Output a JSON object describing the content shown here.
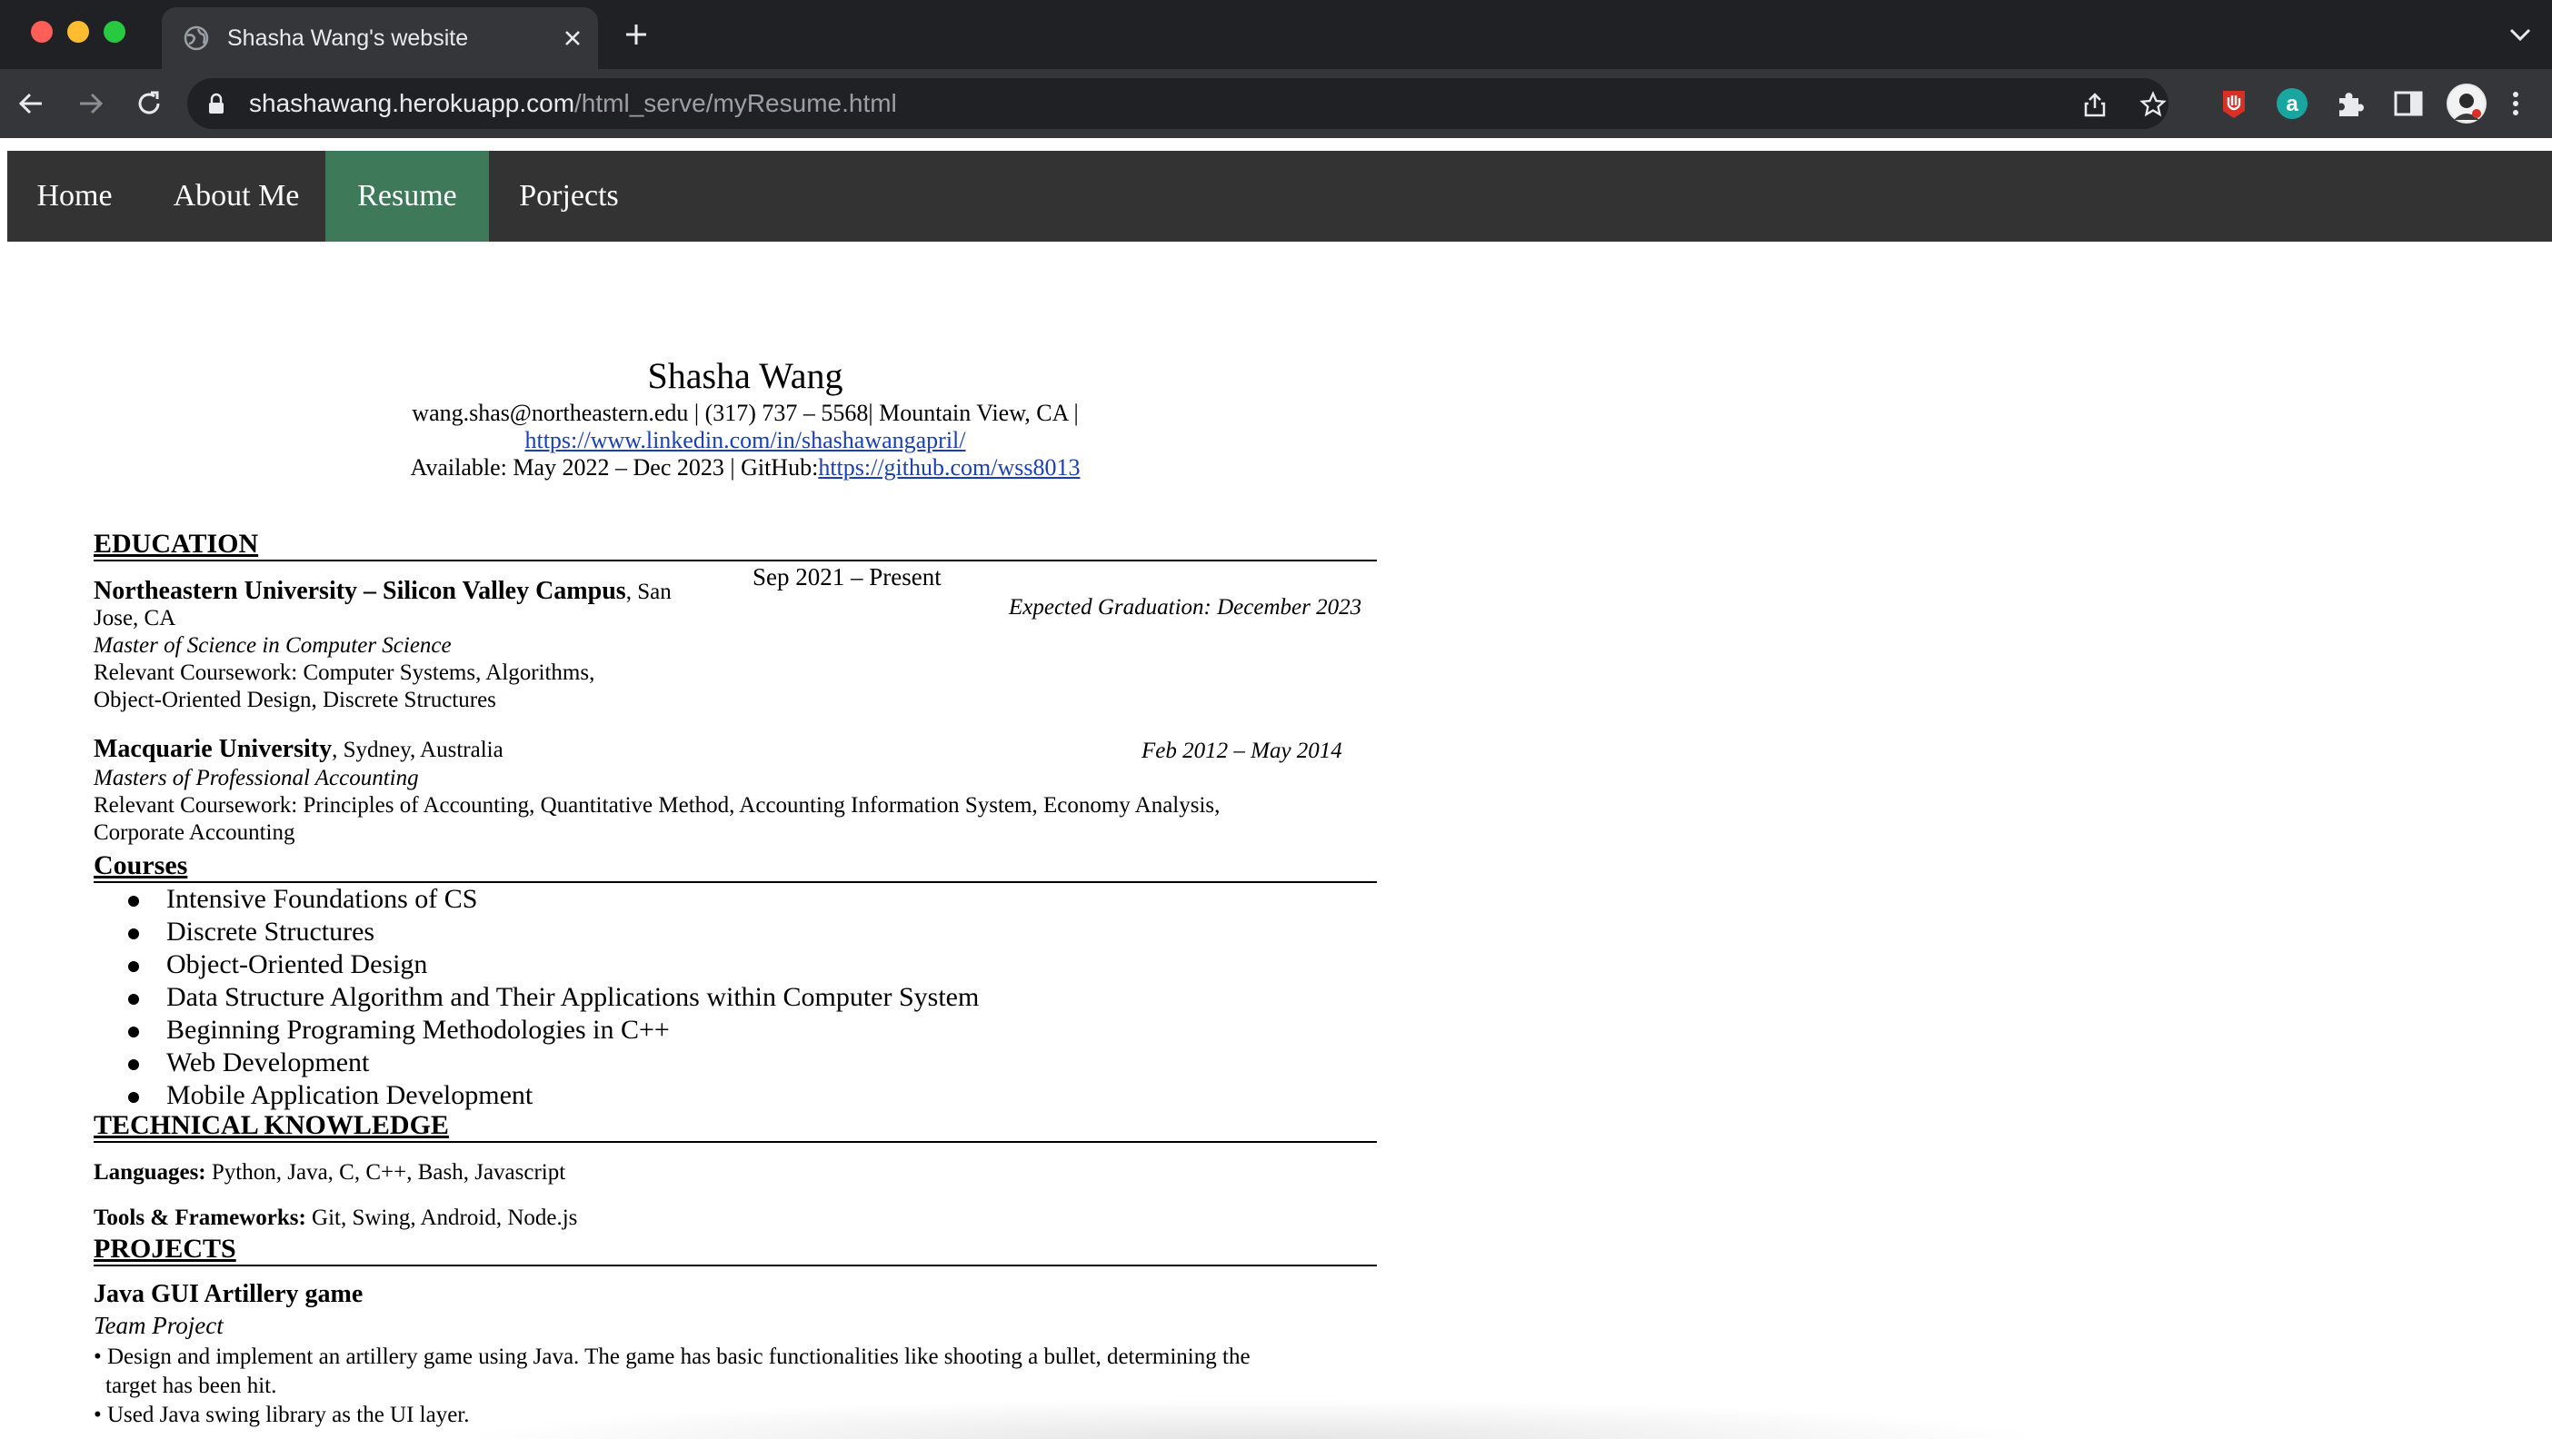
{
  "browser": {
    "tab_title": "Shasha Wang's website",
    "url_host": "shashawang.herokuapp.com",
    "url_path": "/html_serve/myResume.html",
    "icons": [
      "globe-icon",
      "close-icon",
      "plus-icon",
      "chevron-down-icon",
      "back-icon",
      "forward-icon",
      "reload-icon",
      "lock-icon",
      "share-icon",
      "star-icon",
      "extension-red-icon",
      "extension-a-icon",
      "puzzle-icon",
      "sidebar-icon",
      "avatar",
      "kebab-menu-icon"
    ]
  },
  "nav": {
    "items": [
      {
        "label": "Home"
      },
      {
        "label": "About Me"
      },
      {
        "label": "Resume",
        "active": true
      },
      {
        "label": "Porjects"
      }
    ],
    "active_color": "#3e7a5a",
    "bar_color": "#333333"
  },
  "resume": {
    "name": "Shasha Wang",
    "contact_line1": "wang.shas@northeastern.edu | (317) 737 – 5568| Mountain View, CA |",
    "linkedin": "https://www.linkedin.com/in/shashawangapril/",
    "available": "Available: May 2022 – Dec 2023 | GitHub:",
    "github": "https://github.com/wss8013",
    "education_title": "EDUCATION",
    "edu1": {
      "school": "Northeastern University – Silicon Valley Campus",
      "location_a": ", San",
      "location_b": "Jose, CA",
      "dates": "Sep 2021 – Present",
      "expected": "Expected Graduation: December 2023",
      "degree": "Master of Science in Computer Science",
      "coursework_a": "Relevant Coursework: Computer Systems, Algorithms,",
      "coursework_b": "Object-Oriented Design, Discrete Structures"
    },
    "edu2": {
      "school": "Macquarie University",
      "location": ", Sydney, Australia",
      "dates": "Feb 2012 – May 2014",
      "degree": "Masters of Professional Accounting",
      "coursework_a": "Relevant Coursework: Principles of Accounting, Quantitative Method, Accounting Information System, Economy Analysis,",
      "coursework_b": "Corporate Accounting"
    },
    "courses_title": "Courses",
    "courses": [
      "Intensive Foundations of CS",
      "Discrete Structures",
      "Object-Oriented Design",
      "Data Structure Algorithm and Their Applications within Computer System",
      "Beginning  Programing Methodologies in C++",
      "Web Development",
      "Mobile Application Development"
    ],
    "tech_title": "TECHNICAL KNOWLEDGE",
    "languages_label": "Languages:",
    "languages": " Python, Java, C, C++, Bash, Javascript",
    "tools_label": "Tools & Frameworks:",
    "tools": " Git, Swing,  Android, Node.js",
    "projects_title": "PROJECTS",
    "project1": {
      "name": "Java GUI Artillery game",
      "role": "Team Project",
      "bullet1a": "• Design and implement an artillery game using Java. The game has basic functionalities like shooting a bullet, determining the",
      "bullet1b": "target has been hit.",
      "bullet2": "• Used Java swing library as the UI layer."
    }
  }
}
